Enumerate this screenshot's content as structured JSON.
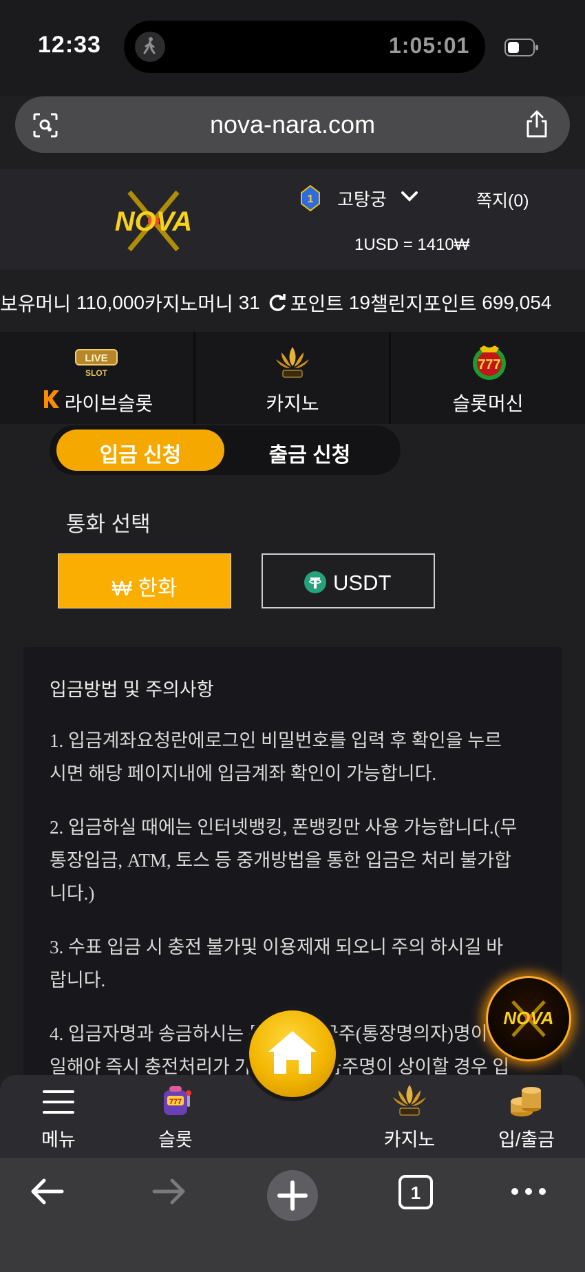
{
  "status_bar": {
    "time": "12:33",
    "activity_timer": "1:05:01"
  },
  "browser": {
    "url": "nova-nara.com"
  },
  "header": {
    "logo_text": "NOVA",
    "user_name": "고탕궁",
    "message_label": "쪽지(0)",
    "exchange_rate": "1USD = 1410₩"
  },
  "balances": {
    "holding_label": "보유머니",
    "holding_value": "110,000",
    "casino_label": "카지노머니",
    "casino_value": "31",
    "point_label": "포인트",
    "point_value": "19",
    "challenge_label": "챌린지포인트",
    "challenge_value": "699,054"
  },
  "categories": {
    "live_slot": "라이브슬롯",
    "casino": "카지노",
    "slot_machine": "슬롯머신",
    "live_badge_text": "LIVE",
    "slot_badge_text": "SLOT"
  },
  "switch": {
    "deposit": "입금 신청",
    "withdraw": "출금 신청"
  },
  "currency": {
    "title": "통화 선택",
    "won": "₩ 한화",
    "usdt": "USDT"
  },
  "info": {
    "title": "입금방법 및 주의사항",
    "p1_l1": "1. 입금계좌요청란에로그인 비밀번호를 입력 후 확인을 누르",
    "p1_l2": "시면 해당 페이지내에 입금계좌 확인이 가능합니다.",
    "p2_l1": "2. 입금하실 때에는 인터넷뱅킹, 폰뱅킹만 사용 가능합니다.(무",
    "p2_l2": "통장입금, ATM, 토스 등 중개방법을 통한 입금은 처리 불가합",
    "p2_l3": "니다.)",
    "p3_l1": "3. 수표 입금 시 충전 불가및 이용제재 되오니 주의 하시길 바",
    "p3_l2": "랍니다.",
    "p4_l1": "4. 입금자명과 송금하시는 통장의 예금주(통장명의자)명이",
    "p4_l2": "일해야 즉시 충전처리가 가능하며 예금주명이 상이할 경우 입"
  },
  "bottom_nav": {
    "menu": "메뉴",
    "slot": "슬롯",
    "casino": "카지노",
    "deposit_withdraw": "입/출금"
  },
  "toolbar": {
    "tab_count": "1"
  },
  "colors": {
    "accent": "#fbae02",
    "background": "#1f1f22",
    "panel": "#18181c"
  }
}
